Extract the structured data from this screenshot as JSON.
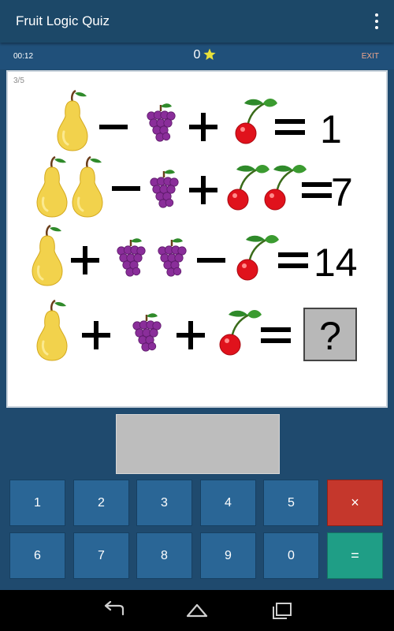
{
  "app": {
    "title": "Fruit Logic Quiz"
  },
  "status": {
    "timer": "00:12",
    "score": "0",
    "exit_label": "EXIT"
  },
  "puzzle": {
    "progress": "3/5",
    "rows": [
      {
        "terms": [
          "pear",
          "-",
          "grapes",
          "+",
          "cherry",
          "=",
          "1"
        ]
      },
      {
        "terms": [
          "pear x2",
          "-",
          "grapes",
          "+",
          "cherry x2",
          "=",
          "7"
        ]
      },
      {
        "terms": [
          "pear",
          "+",
          "grapes x2",
          "-",
          "cherry",
          "=",
          "14"
        ]
      },
      {
        "terms": [
          "pear",
          "+",
          "grapes",
          "+",
          "cherry",
          "=",
          "?"
        ]
      }
    ],
    "results": [
      "1",
      "7",
      "14",
      "?"
    ]
  },
  "answer": {
    "value": ""
  },
  "keypad": {
    "row1": [
      "1",
      "2",
      "3",
      "4",
      "5",
      "×"
    ],
    "row2": [
      "6",
      "7",
      "8",
      "9",
      "0",
      "="
    ]
  },
  "colors": {
    "appbar": "#1c4868",
    "background": "#1f4a6e",
    "key": "#2a6696",
    "clear_key": "#c5372c",
    "enter_key": "#1f9e86",
    "exit_text": "#f2a78c",
    "star": "#e8e13a",
    "pear": "#f2d24c",
    "grape": "#8a2e9a",
    "cherry": "#e0121c",
    "leaf": "#2f8a2a"
  },
  "icons": {
    "menu": "vertical-dots-icon",
    "star": "star-icon",
    "fruits": [
      "pear-icon",
      "grapes-icon",
      "cherry-icon"
    ],
    "nav": [
      "back-icon",
      "home-icon",
      "recents-icon"
    ]
  }
}
